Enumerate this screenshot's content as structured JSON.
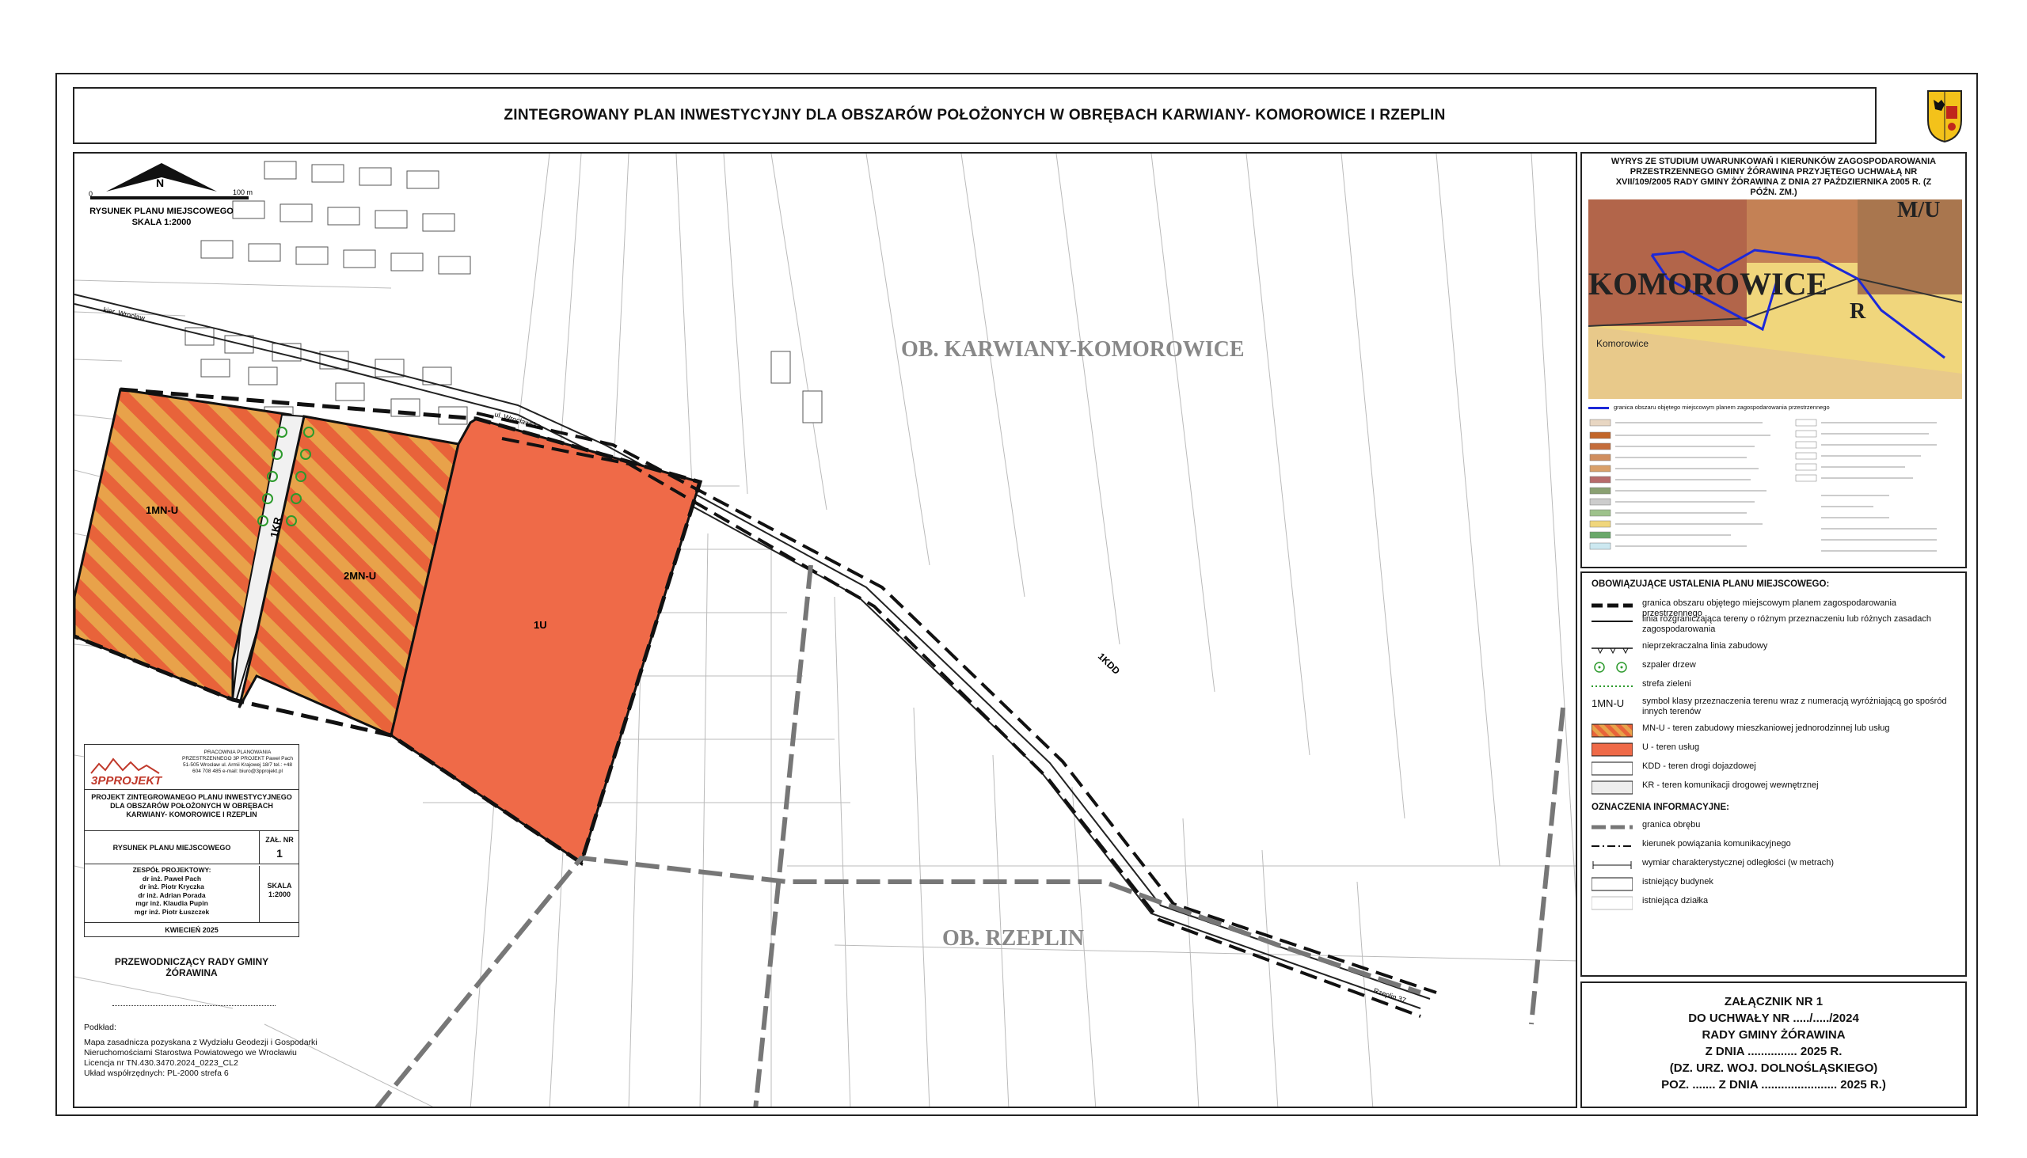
{
  "title": "ZINTEGROWANY PLAN INWESTYCYJNY DLA OBSZARÓW POŁOŻONYCH W OBRĘBACH KARWIANY- KOMOROWICE I RZEPLIN",
  "map": {
    "obreb_north": "OB. KARWIANY-KOMOROWICE",
    "obreb_south": "OB. RZEPLIN",
    "scale_bar_0": "0",
    "scale_bar_100": "100 m",
    "north": "N",
    "drawing_label": "RYSUNEK PLANU MIEJSCOWEGO",
    "drawing_scale": "SKALA 1:2000",
    "street_wroclawska": "ul. Wrocławska",
    "street_kierunek": "kier. Wrocław",
    "street_rzeplin": "Rzeplin 37",
    "zones": {
      "z1": "1MN-U",
      "z2": "2MN-U",
      "z3": "1U",
      "z4": "1KR",
      "road": "1KDD"
    }
  },
  "studium": {
    "title": "WYRYS ZE STUDIUM UWARUNKOWAŃ I KIERUNKÓW ZAGOSPODAROWANIA PRZESTRZENNEGO GMINY ŻÓRAWINA PRZYJĘTEGO UCHWAŁĄ NR XVII/109/2005 RADY GMINY ŻÓRAWINA Z DNIA 27 PAŹDZIERNIKA 2005 R. (Z PÓŹN. ZM.)",
    "map_text_1": "KOMOROWICE",
    "map_text_2": "M/U",
    "map_text_3": "R",
    "map_text_4": "Komorowice",
    "blue_line_label": "granica obszaru objętego miejscowym planem zagospodarowania przestrzennego"
  },
  "legend": {
    "title": "OBOWIĄZUJĄCE USTALENIA PLANU MIEJSCOWEGO:",
    "items": [
      "granica obszaru objętego miejscowym planem zagospodarowania przestrzennego",
      "linia rozgraniczająca tereny o różnym przeznaczeniu lub różnych zasadach zagospodarowania",
      "nieprzekraczalna linia zabudowy",
      "szpaler drzew",
      "strefa zieleni",
      "symbol klasy przeznaczenia terenu wraz z numeracją wyróżniającą go spośród innych terenów",
      "MN-U - teren zabudowy mieszkaniowej jednorodzinnej lub usług",
      "U - teren usług",
      "KDD - teren drogi dojazdowej",
      "KR - teren komunikacji drogowej wewnętrznej"
    ],
    "symbol_label": "1MN-U",
    "info_title": "OZNACZENIA INFORMACYJNE:",
    "info_items": [
      "granica obrębu",
      "kierunek powiązania komunikacyjnego",
      "wymiar charakterystycznej odległości (w metrach)",
      "istniejący budynek",
      "istniejąca działka"
    ]
  },
  "annex": {
    "lines": [
      "ZAŁĄCZNIK NR 1",
      "DO UCHWAŁY NR ...../...../2024",
      "RADY GMINY ŻÓRAWINA",
      "Z DNIA ............... 2025 R.",
      "(DZ. URZ. WOJ. DOLNOŚLĄSKIEGO)",
      "POZ. ....... Z DNIA ....................... 2025 R.)"
    ]
  },
  "titleblock": {
    "company": "3PPROJEKT",
    "company_info": "PRACOWNIA PLANOWANIA PRZESTRZENNEGO 3P PROJEKT Paweł Pach 51-505 Wrocław ul. Armii Krajowej 18/7 tel.: +48 604 708 485 e-mail: biuro@3pprojekt.pl",
    "project": "PROJEKT ZINTEGROWANEGO PLANU INWESTYCYJNEGO DLA OBSZARÓW POŁOŻONYCH W OBRĘBACH KARWIANY- KOMOROWICE I RZEPLIN",
    "drawing": "RYSUNEK PLANU MIEJSCOWEGO",
    "zal_label": "ZAŁ. NR",
    "zal_nr": "1",
    "team_title": "ZESPÓŁ PROJEKTOWY:",
    "team": [
      "dr inż. Paweł Pach",
      "dr inż. Piotr Kryczka",
      "dr inż. Adrian Porada",
      "mgr inż. Klaudia Pupin",
      "mgr inż. Piotr Łuszczek"
    ],
    "scale_label": "SKALA",
    "scale": "1:2000",
    "date": "KWIECIEŃ 2025"
  },
  "przewodniczacy": "PRZEWODNICZĄCY RADY GMINY ŻÓRAWINA",
  "podklad": {
    "title": "Podkład:",
    "lines": [
      "Mapa zasadnicza pozyskana z Wydziału Geodezji i Gospodarki",
      "Nieruchomościami Starostwa Powiatowego we Wrocławiu",
      "Licencja nr TN.430.3470.2024_0223_CL2",
      "Układ współrzędnych: PL-2000 strefa 6"
    ]
  },
  "colors": {
    "mnu_fill": "#e8a24a",
    "mnu_stripe": "#e8633a",
    "u_fill": "#ef6a48",
    "blue_boundary": "#1c28d8"
  }
}
